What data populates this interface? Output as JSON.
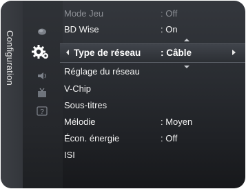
{
  "sidebar": {
    "title": "Configuration"
  },
  "icons": [
    {
      "name": "picture-icon"
    },
    {
      "name": "setup-gear-icon"
    },
    {
      "name": "sound-icon"
    },
    {
      "name": "channel-icon"
    },
    {
      "name": "support-icon"
    }
  ],
  "menu": {
    "items": [
      {
        "label": "Mode Jeu",
        "value": ": Off",
        "dim": true
      },
      {
        "label": "BD Wise",
        "value": ": On"
      },
      {
        "label": "Type de réseau",
        "value": ": Câble",
        "selected": true
      },
      {
        "label": "Réglage du réseau",
        "value": ""
      },
      {
        "label": "V-Chip",
        "value": ""
      },
      {
        "label": "Sous-titres",
        "value": ""
      },
      {
        "label": "Mélodie",
        "value": ": Moyen"
      },
      {
        "label": "Écon. énergie",
        "value": ": Off"
      },
      {
        "label": "ISI",
        "value": ""
      }
    ]
  },
  "colors": {
    "background": "#2a2d32",
    "text": "#f2f2f2",
    "dim_text": "#8c8f95",
    "highlight": "#40444b"
  }
}
